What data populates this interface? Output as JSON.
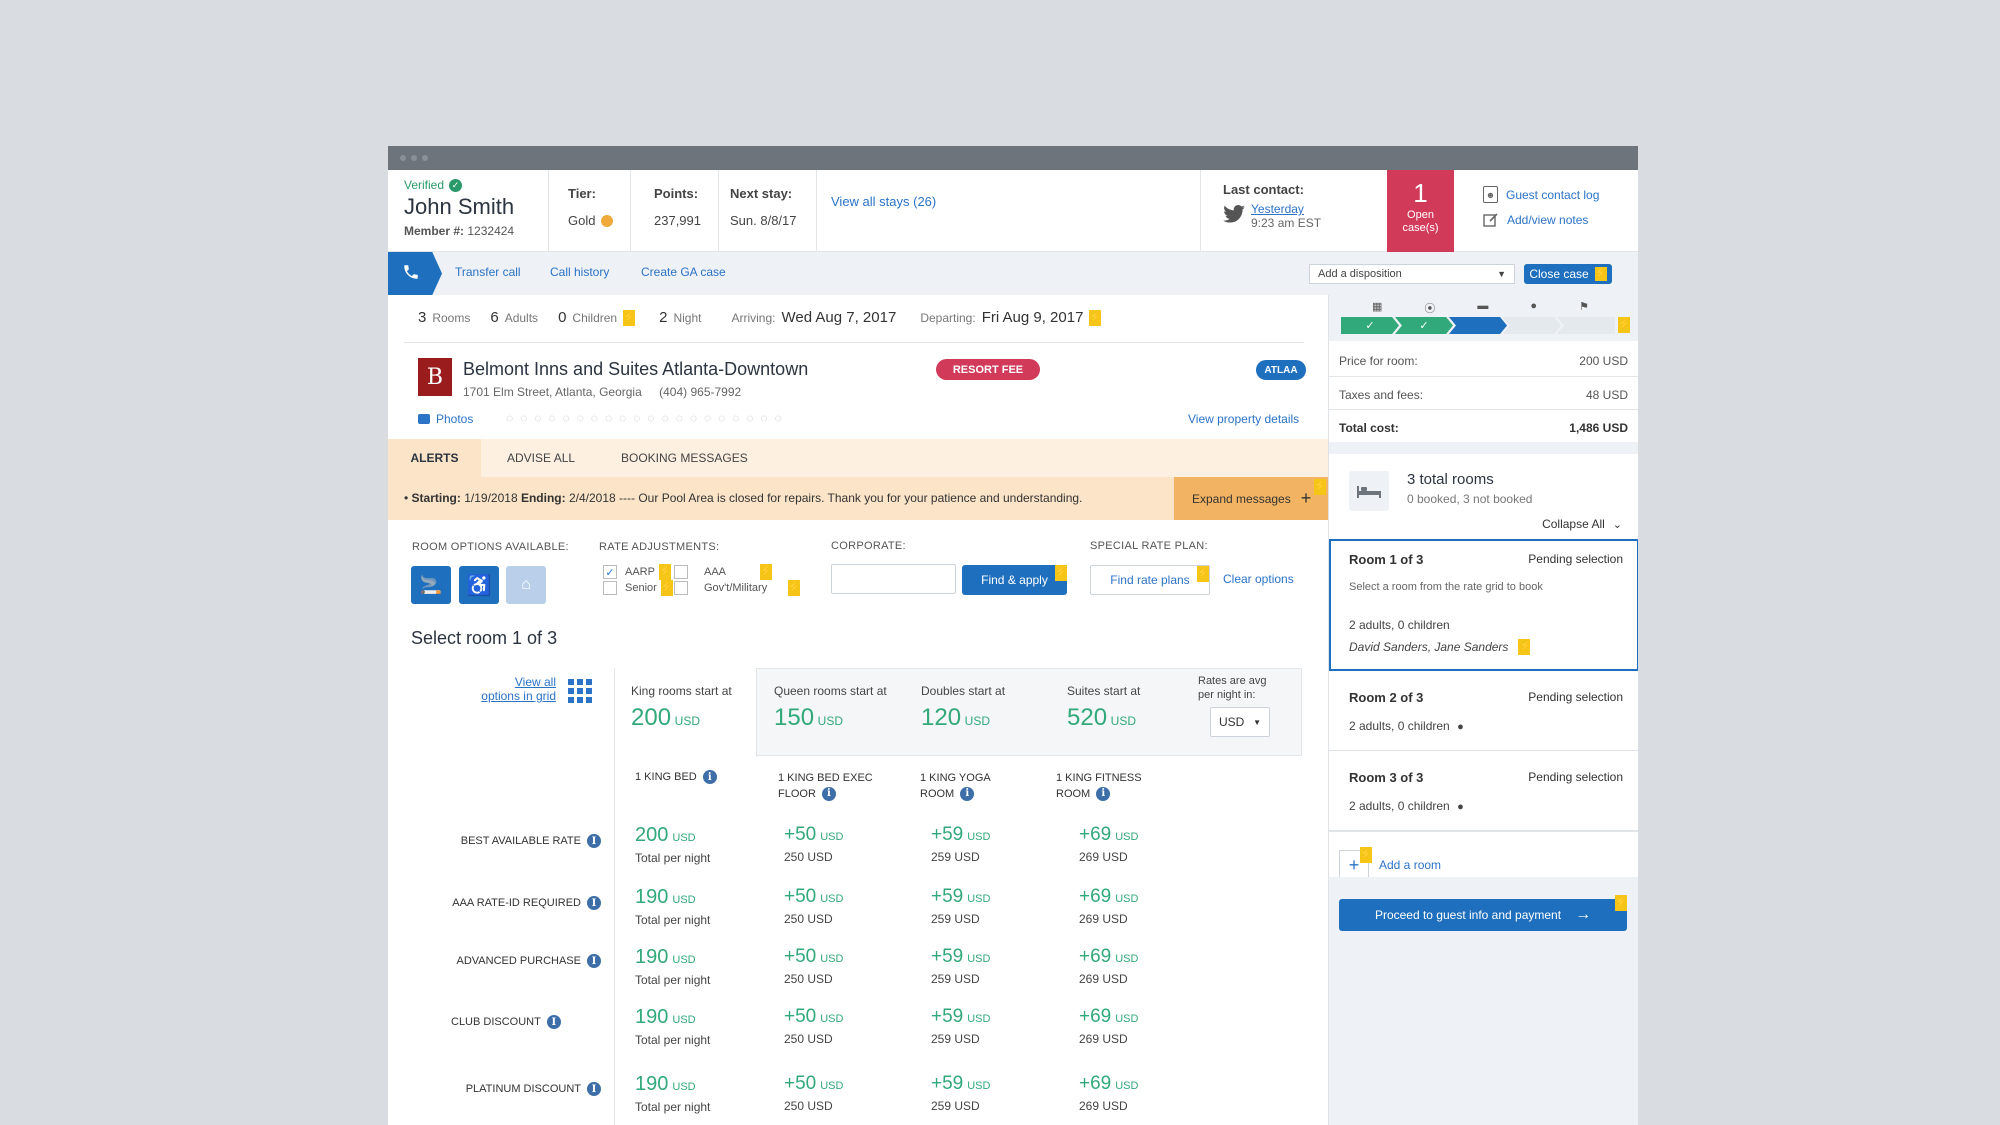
{
  "header": {
    "verified_label": "Verified",
    "guest_name": "John Smith",
    "member_label": "Member #:",
    "member_number": "1232424",
    "tier_label": "Tier:",
    "tier_value": "Gold",
    "points_label": "Points:",
    "points_value": "237,991",
    "next_stay_label": "Next stay:",
    "next_stay_value": "Sun. 8/8/17",
    "view_all_stays": "View all stays (26)",
    "last_contact_label": "Last contact:",
    "last_contact_date": "Yesterday",
    "last_contact_time": "9:23 am EST",
    "open_cases_count": "1",
    "open_cases_label1": "Open",
    "open_cases_label2": "case(s)",
    "guest_contact_log": "Guest contact log",
    "add_view_notes": "Add/view notes",
    "colors": {
      "accent": "#1e6fbd",
      "cases": "#d23a5a",
      "gold": "#f0a93b"
    }
  },
  "actions": {
    "transfer_call": "Transfer call",
    "call_history": "Call history",
    "create_ga_case": "Create GA case",
    "disposition_placeholder": "Add a disposition",
    "close_case": "Close case"
  },
  "stay": {
    "rooms_n": "3",
    "rooms_l": "Rooms",
    "adults_n": "6",
    "adults_l": "Adults",
    "children_n": "0",
    "children_l": "Children",
    "nights_n": "2",
    "nights_l": "Night",
    "arriving_l": "Arriving:",
    "arriving_v": "Wed Aug 7, 2017",
    "departing_l": "Departing:",
    "departing_v": "Fri Aug 9, 2017"
  },
  "property": {
    "logo_letter": "B",
    "name": "Belmont Inns and Suites Atlanta-Downtown",
    "address": "1701 Elm Street, Atlanta, Georgia",
    "phone": "(404) 965-7992",
    "resort_fee": "RESORT FEE",
    "code": "ATLAA",
    "photos": "Photos",
    "view_details": "View property details"
  },
  "tabs": [
    "ALERTS",
    "ADVISE ALL",
    "BOOKING MESSAGES"
  ],
  "alert": {
    "start_label": "Starting:",
    "start_date": "1/19/2018",
    "end_label": "Ending:",
    "end_date": "2/4/2018",
    "message": "---- Our Pool Area is closed for repairs. Thank you for your patience and understanding.",
    "expand": "Expand messages"
  },
  "filters": {
    "room_options_label": "ROOM OPTIONS AVAILABLE:",
    "rate_adj_label": "RATE ADJUSTMENTS:",
    "aarp": "AARP",
    "aaa": "AAA",
    "senior": "Senior",
    "govt": "Gov't/Military",
    "corporate_label": "CORPORATE:",
    "find_apply": "Find & apply",
    "special_rate_label": "SPECIAL RATE PLAN:",
    "find_rate_plans": "Find rate plans",
    "clear_options": "Clear options"
  },
  "select_title": "Select room 1 of 3",
  "grid": {
    "view_all_1": "View all",
    "view_all_2": "options in grid",
    "start_cols": [
      {
        "label": "King rooms start at",
        "price": "200",
        "unit": "USD"
      },
      {
        "label": "Queen rooms start at",
        "price": "150",
        "unit": "USD"
      },
      {
        "label": "Doubles start at",
        "price": "120",
        "unit": "USD"
      },
      {
        "label": "Suites start at",
        "price": "520",
        "unit": "USD"
      }
    ],
    "rates_avg_1": "Rates are avg",
    "rates_avg_2": "per night in:",
    "currency": "USD",
    "room_types": [
      {
        "line1": "1 KING BED",
        "line2": ""
      },
      {
        "line1": "1 KING BED EXEC",
        "line2": "FLOOR"
      },
      {
        "line1": "1 KING YOGA",
        "line2": "ROOM"
      },
      {
        "line1": "1 KING FITNESS",
        "line2": "ROOM"
      }
    ],
    "rows": [
      {
        "label": "BEST AVAILABLE RATE",
        "base": "200",
        "base_note": "Total per night",
        "adds": [
          "+50",
          "+59",
          "+69"
        ],
        "totals": [
          "250 USD",
          "259 USD",
          "269 USD"
        ]
      },
      {
        "label": "AAA RATE-ID REQUIRED",
        "base": "190",
        "base_note": "Total per night",
        "adds": [
          "+50",
          "+59",
          "+69"
        ],
        "totals": [
          "250 USD",
          "259 USD",
          "269 USD"
        ]
      },
      {
        "label": "ADVANCED PURCHASE",
        "base": "190",
        "base_note": "Total per night",
        "adds": [
          "+50",
          "+59",
          "+69"
        ],
        "totals": [
          "250 USD",
          "259 USD",
          "269 USD"
        ]
      },
      {
        "label": "CLUB DISCOUNT",
        "base": "190",
        "base_note": "Total per night",
        "adds": [
          "+50",
          "+59",
          "+69"
        ],
        "totals": [
          "250 USD",
          "259 USD",
          "269 USD"
        ]
      },
      {
        "label": "PLATINUM DISCOUNT",
        "base": "190",
        "base_note": "Total per night",
        "adds": [
          "+50",
          "+59",
          "+69"
        ],
        "totals": [
          "250 USD",
          "259 USD",
          "269 USD"
        ]
      }
    ],
    "unit": "USD"
  },
  "summary": {
    "price_label": "Price for room:",
    "price_value": "200 USD",
    "taxes_label": "Taxes and fees:",
    "taxes_value": "48 USD",
    "total_label": "Total cost:",
    "total_value": "1,486 USD",
    "rooms_title": "3 total rooms",
    "rooms_sub": "0 booked, 3 not booked",
    "collapse_all": "Collapse All",
    "rooms": [
      {
        "title": "Room 1 of 3",
        "status": "Pending selection",
        "hint": "Select a room from the rate grid to book",
        "guests": "2 adults, 0 children",
        "names": "David Sanders, Jane Sanders"
      },
      {
        "title": "Room 2 of 3",
        "status": "Pending selection",
        "guests": "2 adults, 0 children"
      },
      {
        "title": "Room 3 of 3",
        "status": "Pending selection",
        "guests": "2 adults, 0 children"
      }
    ],
    "add_room": "Add a room",
    "proceed": "Proceed to guest info and payment"
  }
}
